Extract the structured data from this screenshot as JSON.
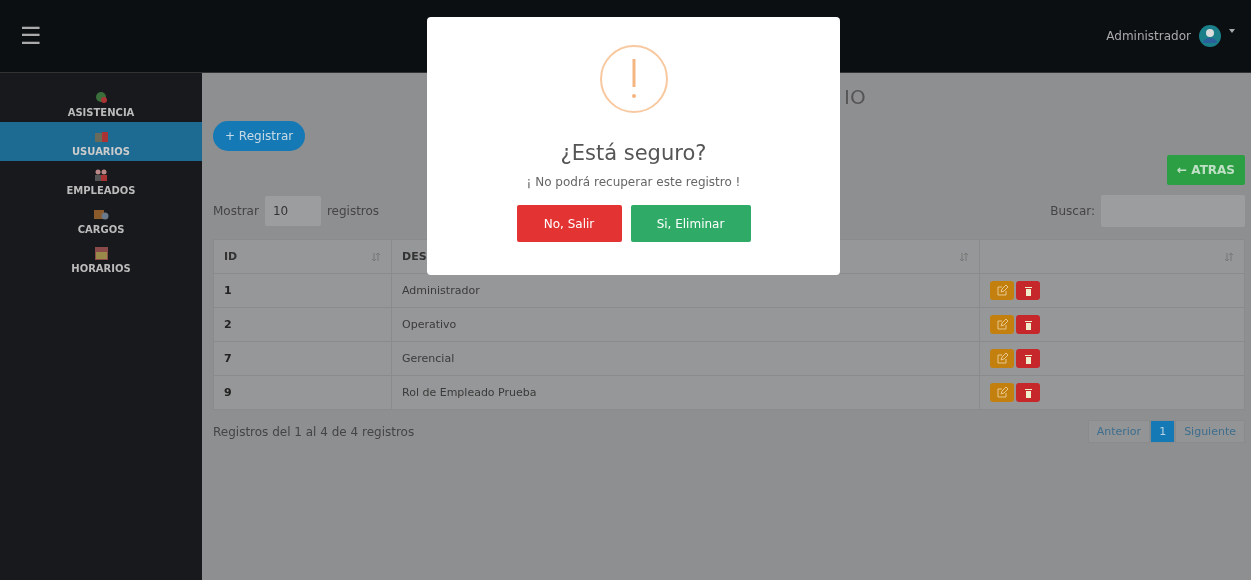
{
  "topbar": {
    "menu_icon": "☰",
    "user": "Administrador"
  },
  "sidebar": {
    "items": [
      {
        "label": "ASISTENCIA",
        "selected": false
      },
      {
        "label": "USUARIOS",
        "selected": true
      },
      {
        "label": "EMPLEADOS",
        "selected": false
      },
      {
        "label": "CARGOS",
        "selected": false
      },
      {
        "label": "HORARIOS",
        "selected": false
      }
    ]
  },
  "page": {
    "title": "IO",
    "register_button": "+ Registrar",
    "back_button": "← ATRAS",
    "length": {
      "prefix": "Mostrar",
      "value": "10",
      "suffix": "registros"
    },
    "search_label": "Buscar:"
  },
  "table": {
    "columns": [
      "ID",
      "DES"
    ],
    "rows": [
      {
        "id": "1",
        "description": "Administrador"
      },
      {
        "id": "2",
        "description": "Operativo"
      },
      {
        "id": "7",
        "description": "Gerencial"
      },
      {
        "id": "9",
        "description": "Rol de Empleado Prueba"
      }
    ]
  },
  "footer": {
    "info": "Registros del 1 al 4 de 4 registros",
    "pagination": [
      {
        "label": "Anterior",
        "selected": false
      },
      {
        "label": "1",
        "selected": true
      },
      {
        "label": "Siguiente",
        "selected": false
      }
    ]
  },
  "dialog": {
    "title": "¿Está seguro?",
    "message": "¡ No podrá recuperar este registro !",
    "buttons": [
      {
        "label": "No, Salir",
        "kind": "cancel"
      },
      {
        "label": "Si, Eliminar",
        "kind": "confirm"
      }
    ]
  }
}
